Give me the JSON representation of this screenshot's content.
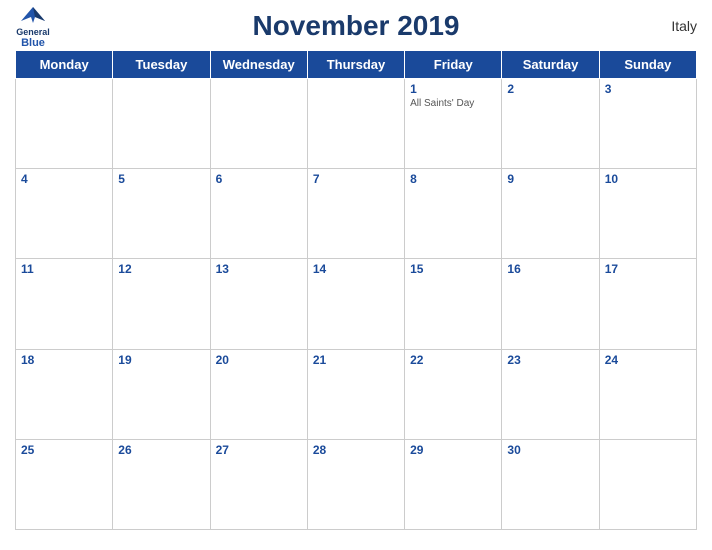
{
  "header": {
    "title": "November 2019",
    "country": "Italy",
    "logo": {
      "general": "General",
      "blue": "Blue"
    }
  },
  "weekdays": [
    "Monday",
    "Tuesday",
    "Wednesday",
    "Thursday",
    "Friday",
    "Saturday",
    "Sunday"
  ],
  "weeks": [
    [
      {
        "date": "",
        "holiday": ""
      },
      {
        "date": "",
        "holiday": ""
      },
      {
        "date": "",
        "holiday": ""
      },
      {
        "date": "",
        "holiday": ""
      },
      {
        "date": "1",
        "holiday": "All Saints' Day"
      },
      {
        "date": "2",
        "holiday": ""
      },
      {
        "date": "3",
        "holiday": ""
      }
    ],
    [
      {
        "date": "4",
        "holiday": ""
      },
      {
        "date": "5",
        "holiday": ""
      },
      {
        "date": "6",
        "holiday": ""
      },
      {
        "date": "7",
        "holiday": ""
      },
      {
        "date": "8",
        "holiday": ""
      },
      {
        "date": "9",
        "holiday": ""
      },
      {
        "date": "10",
        "holiday": ""
      }
    ],
    [
      {
        "date": "11",
        "holiday": ""
      },
      {
        "date": "12",
        "holiday": ""
      },
      {
        "date": "13",
        "holiday": ""
      },
      {
        "date": "14",
        "holiday": ""
      },
      {
        "date": "15",
        "holiday": ""
      },
      {
        "date": "16",
        "holiday": ""
      },
      {
        "date": "17",
        "holiday": ""
      }
    ],
    [
      {
        "date": "18",
        "holiday": ""
      },
      {
        "date": "19",
        "holiday": ""
      },
      {
        "date": "20",
        "holiday": ""
      },
      {
        "date": "21",
        "holiday": ""
      },
      {
        "date": "22",
        "holiday": ""
      },
      {
        "date": "23",
        "holiday": ""
      },
      {
        "date": "24",
        "holiday": ""
      }
    ],
    [
      {
        "date": "25",
        "holiday": ""
      },
      {
        "date": "26",
        "holiday": ""
      },
      {
        "date": "27",
        "holiday": ""
      },
      {
        "date": "28",
        "holiday": ""
      },
      {
        "date": "29",
        "holiday": ""
      },
      {
        "date": "30",
        "holiday": ""
      },
      {
        "date": "",
        "holiday": ""
      }
    ]
  ]
}
